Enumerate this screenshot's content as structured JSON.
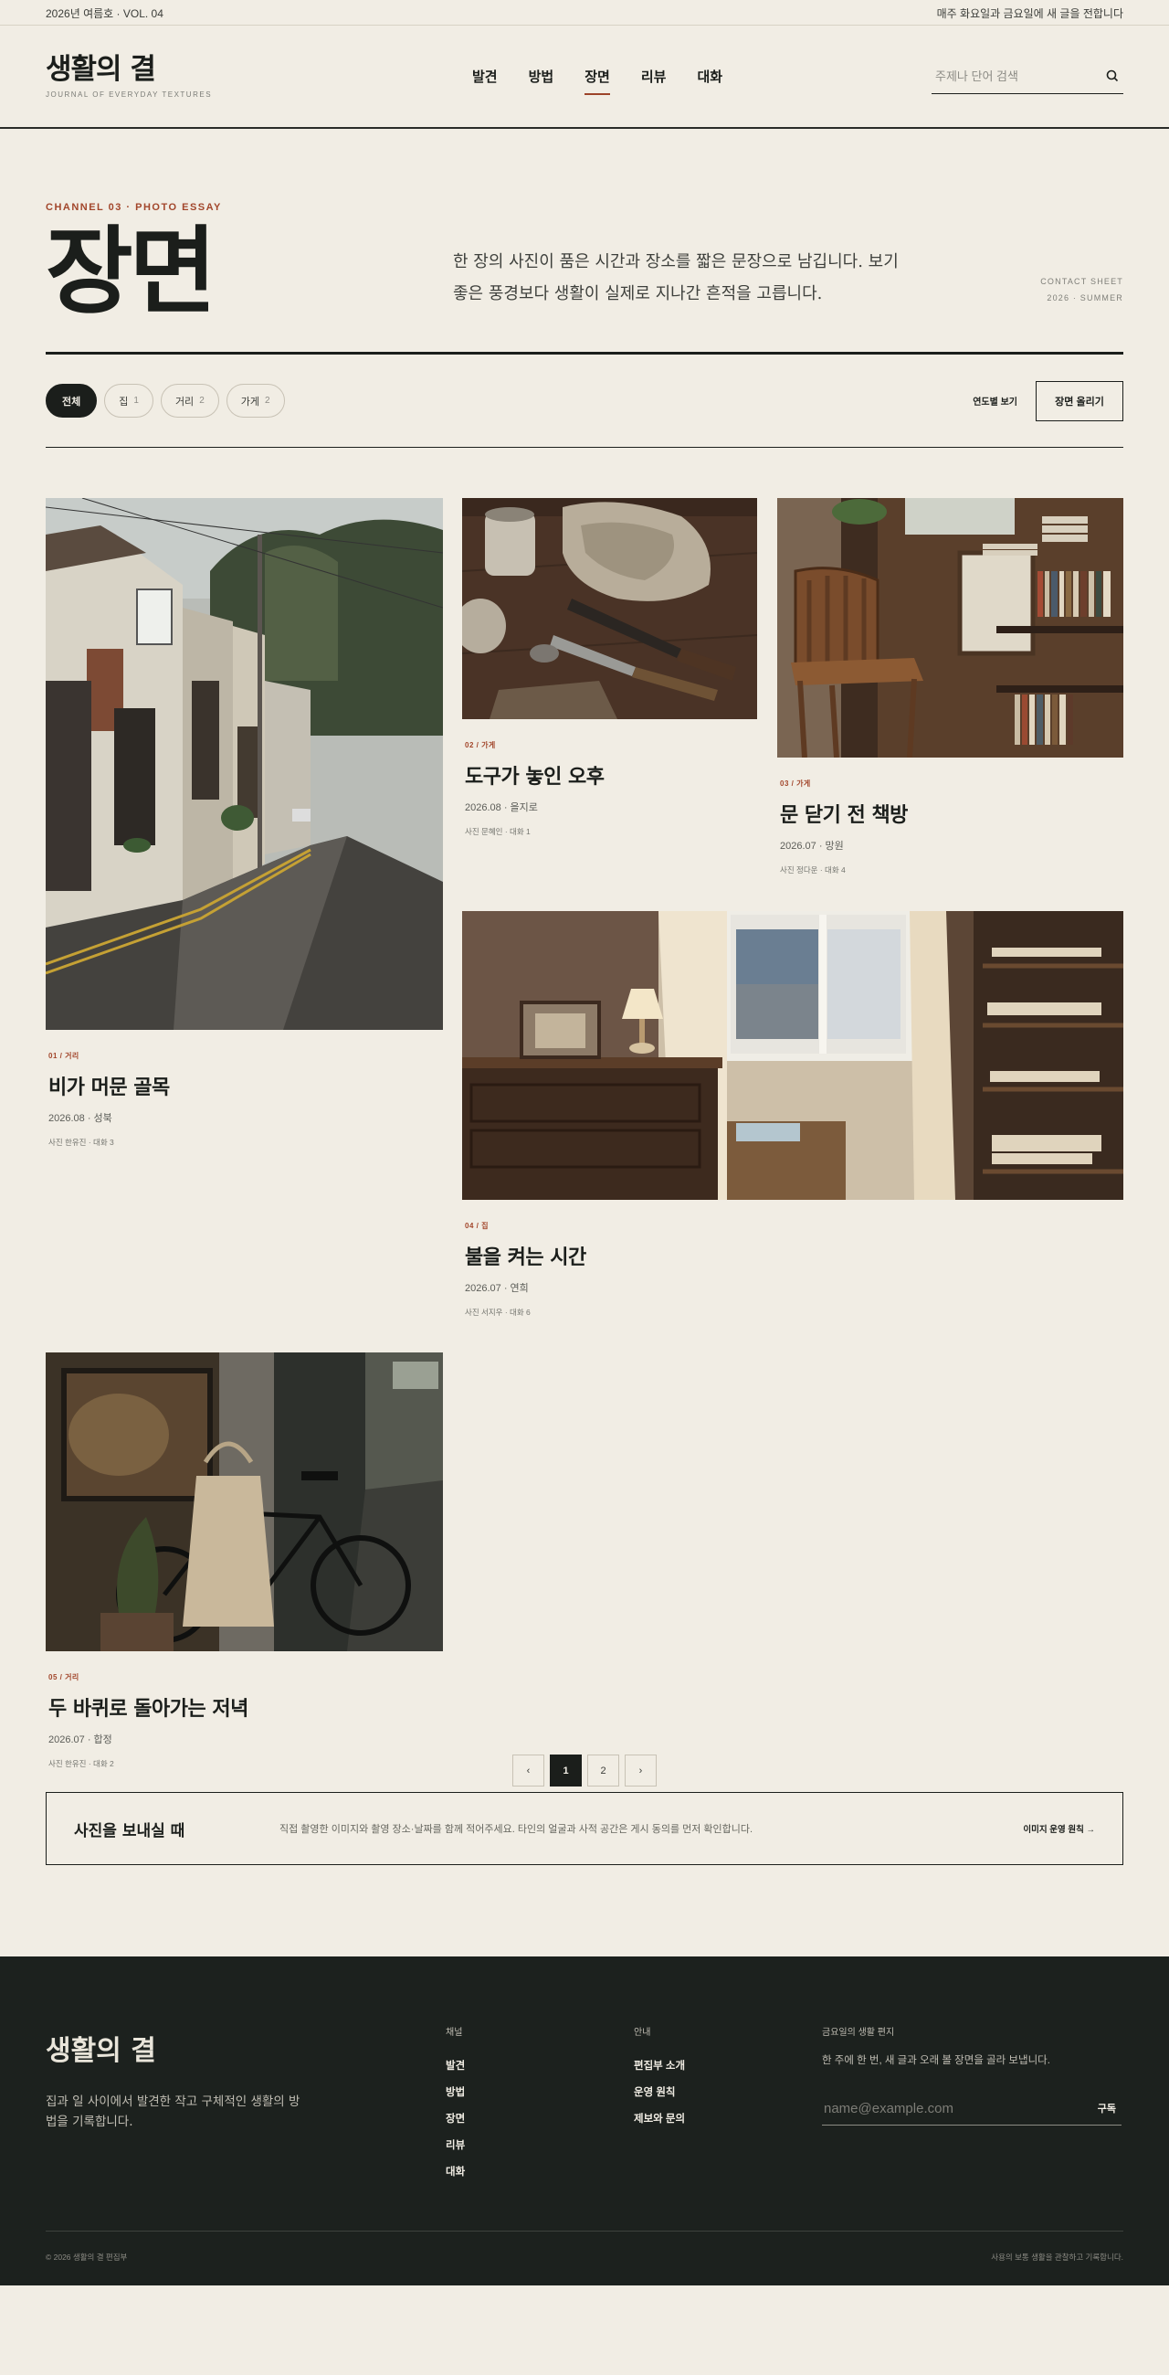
{
  "topbar": {
    "issue": "2026년 여름호 · VOL. 04",
    "notice": "매주 화요일과 금요일에 새 글을 전합니다"
  },
  "header": {
    "brand_title": "생활의 결",
    "brand_sub": "JOURNAL OF EVERYDAY TEXTURES",
    "nav": [
      {
        "label": "발견",
        "active": false
      },
      {
        "label": "방법",
        "active": false
      },
      {
        "label": "장면",
        "active": true
      },
      {
        "label": "리뷰",
        "active": false
      },
      {
        "label": "대화",
        "active": false
      }
    ],
    "search_placeholder": "주제나 단어 검색",
    "search_icon": "search-icon"
  },
  "hero": {
    "kicker": "CHANNEL 03 · PHOTO ESSAY",
    "title": "장면",
    "desc_line1": "한 장의 사진이 품은 시간과 장소를 짧은 문장으로 남깁니다. 보기",
    "desc_line2": "좋은 풍경보다 생활이 실제로 지나간 흔적을 고릅니다.",
    "meta_line1": "CONTACT SHEET",
    "meta_line2": "2026 · SUMMER"
  },
  "filters": {
    "chips": [
      {
        "label": "전체",
        "count": "",
        "active": true
      },
      {
        "label": "집",
        "count": "1",
        "active": false
      },
      {
        "label": "거리",
        "count": "2",
        "active": false
      },
      {
        "label": "가게",
        "count": "2",
        "active": false
      }
    ],
    "year_view": "연도별 보기",
    "post_button": "장면 올리기"
  },
  "cards": [
    {
      "category": "01 / 거리",
      "title": "비가 머문 골목",
      "date": "2026.08 · 성북",
      "photographer": "사진 한유진 · 대화 3",
      "scene": "rainy-alley"
    },
    {
      "category": "02 / 가게",
      "title": "도구가 놓인 오후",
      "date": "2026.08 · 을지로",
      "photographer": "사진 문혜인 · 대화 1",
      "scene": "workbench-tools"
    },
    {
      "category": "03 / 가게",
      "title": "문 닫기 전 책방",
      "date": "2026.07 · 망원",
      "photographer": "사진 정다운 · 대화 4",
      "scene": "bookshop-chair"
    },
    {
      "category": "04 / 집",
      "title": "불을 켜는 시간",
      "date": "2026.07 · 연희",
      "photographer": "사진 서지우 · 대화 6",
      "scene": "room-window-lamp"
    },
    {
      "category": "05 / 거리",
      "title": "두 바퀴로 돌아가는 저녁",
      "date": "2026.07 · 합정",
      "photographer": "사진 한유진 · 대화 2",
      "scene": "bicycle-evening"
    }
  ],
  "pagination": {
    "prev": "‹",
    "pages": [
      "1",
      "2"
    ],
    "current": "1",
    "next": "›"
  },
  "submit": {
    "title": "사진을 보내실 때",
    "desc": "직접 촬영한 이미지와 촬영 장소·날짜를 함께 적어주세요. 타인의 얼굴과 사적 공간은 게시 동의를 먼저 확인합니다.",
    "link": "이미지 운영 원칙 →"
  },
  "footer": {
    "brand_title": "생활의 결",
    "brand_desc": "집과 일 사이에서 발견한 작고 구체적인 생활의 방법을 기록합니다.",
    "channel_head": "채널",
    "channels": [
      "발견",
      "방법",
      "장면",
      "리뷰",
      "대화"
    ],
    "info_head": "안내",
    "info_links": [
      "편집부 소개",
      "운영 원칙",
      "제보와 문의"
    ],
    "newsletter_head": "금요일의 생활 편지",
    "newsletter_text": "한 주에 한 번, 새 글과 오래 볼 장면을 골라 보냅니다.",
    "email_placeholder": "name@example.com",
    "subscribe": "구독",
    "copyright": "© 2026 생활의 결 편집부",
    "policy": "사용의 보통 생활을 관찰하고 기록합니다."
  },
  "colors": {
    "background": "#f1ede4",
    "ink": "#1b1e1b",
    "accent": "#a2462b",
    "footer": "#1c211e"
  }
}
